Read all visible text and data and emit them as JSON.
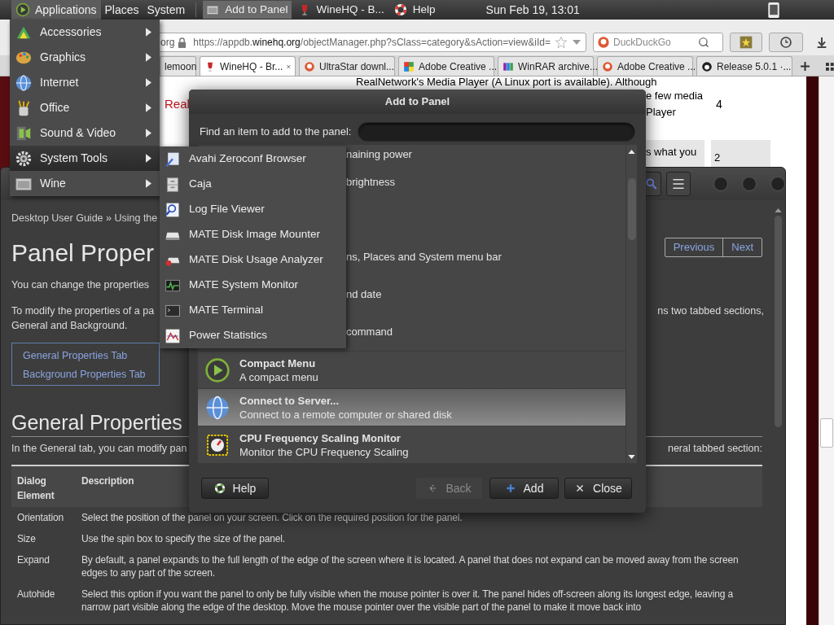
{
  "top_panel": {
    "menus": [
      {
        "label": "Applications",
        "selected": true
      },
      {
        "label": "Places",
        "selected": false
      },
      {
        "label": "System",
        "selected": false
      }
    ],
    "tasks": [
      {
        "label": "Add to Panel",
        "selected": true
      },
      {
        "label": "WineHQ - B...",
        "selected": false
      },
      {
        "label": "Help",
        "selected": false
      }
    ],
    "clock": "Sun Feb 19, 13:01"
  },
  "browser": {
    "site_identity": "org",
    "url": "https://appdb.**winehq.org**/objectManager.php?sClass=category&sAction=view&iId=",
    "search_placeholder": "DuckDuckGo",
    "tabs": [
      {
        "label": "lemoon",
        "selected": false
      },
      {
        "label": "WineHQ - Br...",
        "selected": true
      },
      {
        "label": "UltraStar downl...",
        "selected": false
      },
      {
        "label": "Adobe Creative ...",
        "selected": false
      },
      {
        "label": "WinRAR archive...",
        "selected": false
      },
      {
        "label": "Adobe Creative ...",
        "selected": false
      },
      {
        "label": "Release 5.0.1 ·...",
        "selected": false
      }
    ],
    "page": {
      "intro": "RealNetwork's Media Player (A Linux port is available). Although",
      "link": "Real",
      "fragment_lines": [
        "e few media",
        "Player"
      ],
      "rating": "4",
      "cells": [
        "s what you",
        "2"
      ]
    }
  },
  "help_window": {
    "breadcrumb": "Desktop User Guide » Using the",
    "title": "Panel Proper",
    "nav": [
      "Previous",
      "Next"
    ],
    "paragraph_1": "You can change the properties",
    "paragraph_2_left": [
      "To modify the properties of a pa",
      "General and Background."
    ],
    "paragraph_2_right": "ns two tabbed sections,",
    "links": [
      "General Properties Tab",
      "Background Properties Tab"
    ],
    "section_title": "General Properties",
    "section_intro_left": "In the General tab, you can modify pan",
    "section_intro_right": "neral tabbed section:",
    "table": {
      "columns": [
        "Dialog Element",
        "Description"
      ],
      "rows": [
        {
          "element": "Orientation",
          "description": "Select the position of the panel on your screen. Click on the required position for the panel."
        },
        {
          "element": "Size",
          "description": "Use the spin box to specify the size of the panel."
        },
        {
          "element": "Expand",
          "description": "By default, a panel expands to the full length of the edge of the screen where it is located. A panel that does not expand can be moved away from the screen edges to any part of the screen."
        },
        {
          "element": "Autohide",
          "description": "Select this option if you want the panel to only be fully visible when the mouse pointer is over it. The panel hides off-screen along its longest edge, leaving a narrow part visible along the edge of the desktop. Move the mouse pointer over the visible part of the panel to make it move back into"
        }
      ]
    }
  },
  "dialog": {
    "title": "Add to Panel",
    "find_label": "Find an item to add to the panel:",
    "items": [
      {
        "kind": "cut",
        "description": "naining power",
        "selected": false
      },
      {
        "kind": "fragment",
        "description": "brightness",
        "selected": false
      },
      {
        "kind": "hidden",
        "selected": false
      },
      {
        "kind": "fragment",
        "description": "ns, Places and System menu bar",
        "selected": false
      },
      {
        "kind": "fragment",
        "description": "nd date",
        "selected": false
      },
      {
        "kind": "fragment",
        "description": "command",
        "selected": false
      },
      {
        "kind": "full",
        "title": "Compact Menu",
        "description": "A compact menu",
        "selected": false
      },
      {
        "kind": "full",
        "title": "Connect to Server...",
        "description": "Connect to a remote computer or shared disk",
        "selected": true
      },
      {
        "kind": "full",
        "title": "CPU Frequency Scaling Monitor",
        "description": "Monitor the CPU Frequency Scaling",
        "selected": false
      }
    ],
    "buttons": [
      {
        "label": "Help",
        "kind": "help",
        "disabled": false
      },
      {
        "label": "Back",
        "kind": "back",
        "disabled": true
      },
      {
        "label": "Add",
        "kind": "add",
        "disabled": false
      },
      {
        "label": "Close",
        "kind": "close",
        "disabled": false
      }
    ]
  },
  "applications_menu": [
    {
      "label": "Accessories",
      "selected": false
    },
    {
      "label": "Graphics",
      "selected": false
    },
    {
      "label": "Internet",
      "selected": false
    },
    {
      "label": "Office",
      "selected": false
    },
    {
      "label": "Sound & Video",
      "selected": false
    },
    {
      "label": "System Tools",
      "selected": true
    },
    {
      "label": "Wine",
      "selected": false
    }
  ],
  "system_tools_menu": [
    "Avahi Zeroconf Browser",
    "Caja",
    "Log File Viewer",
    "MATE Disk Image Mounter",
    "MATE Disk Usage Analyzer",
    "MATE System Monitor",
    "MATE Terminal",
    "Power Statistics"
  ]
}
